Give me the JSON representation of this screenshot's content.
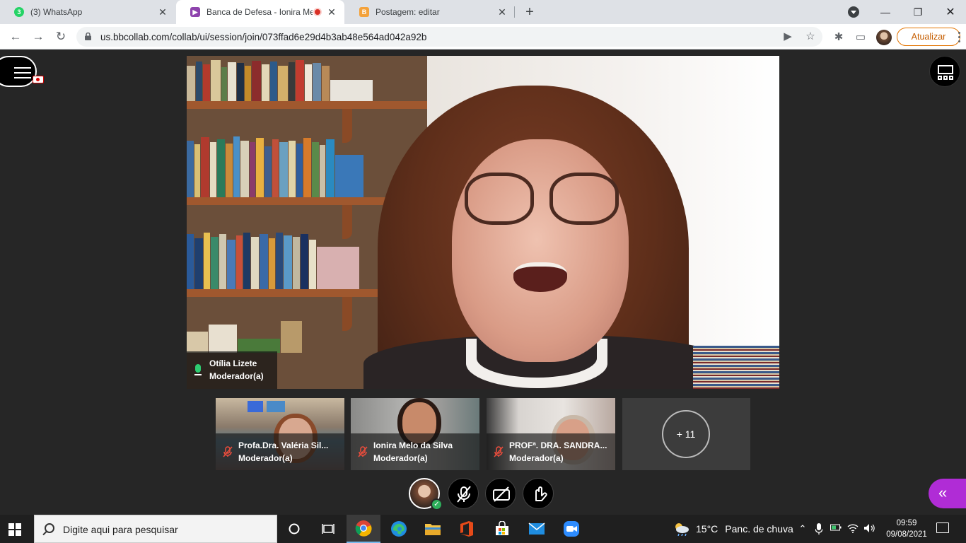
{
  "browser": {
    "tabs": [
      {
        "title": "(3) WhatsApp",
        "badge": "3",
        "favicon_color": "#25d366"
      },
      {
        "title": "Banca de Defesa - Ionira Me",
        "favicon_color": "#8e44ad",
        "recording": true
      },
      {
        "title": "Postagem: editar",
        "favicon_color": "#f4a23a"
      }
    ],
    "url": "us.bbcollab.com/collab/ui/session/join/073ffad6e29d4b3ab48e564ad042a92b",
    "update_label": "Atualizar"
  },
  "session": {
    "main_speaker": {
      "name": "Otília Lizete",
      "role": "Moderador(a)",
      "mic": "on"
    },
    "participants": [
      {
        "name": "Profa.Dra. Valéria Sil...",
        "role": "Moderador(a)",
        "mic": "muted"
      },
      {
        "name": "Ionira Melo da Silva",
        "role": "Moderador(a)",
        "mic": "muted"
      },
      {
        "name": "PROFª. DRA. SANDRA...",
        "role": "Moderador(a)",
        "mic": "muted"
      }
    ],
    "more_participants": "+ 11",
    "controls": [
      "avatar",
      "mute-microphone",
      "camera-off",
      "raise-hand"
    ],
    "colors": {
      "accent": "#b02cd6",
      "status_ok": "#2eaf5b",
      "muted": "#e74c3c"
    }
  },
  "taskbar": {
    "search_placeholder": "Digite aqui para pesquisar",
    "apps": [
      "task-view",
      "chrome",
      "edge",
      "file-explorer",
      "office",
      "store",
      "mail",
      "zoom"
    ],
    "weather_temp": "15°C",
    "weather_text": "Panc. de chuva",
    "time": "09:59",
    "date": "09/08/2021"
  }
}
